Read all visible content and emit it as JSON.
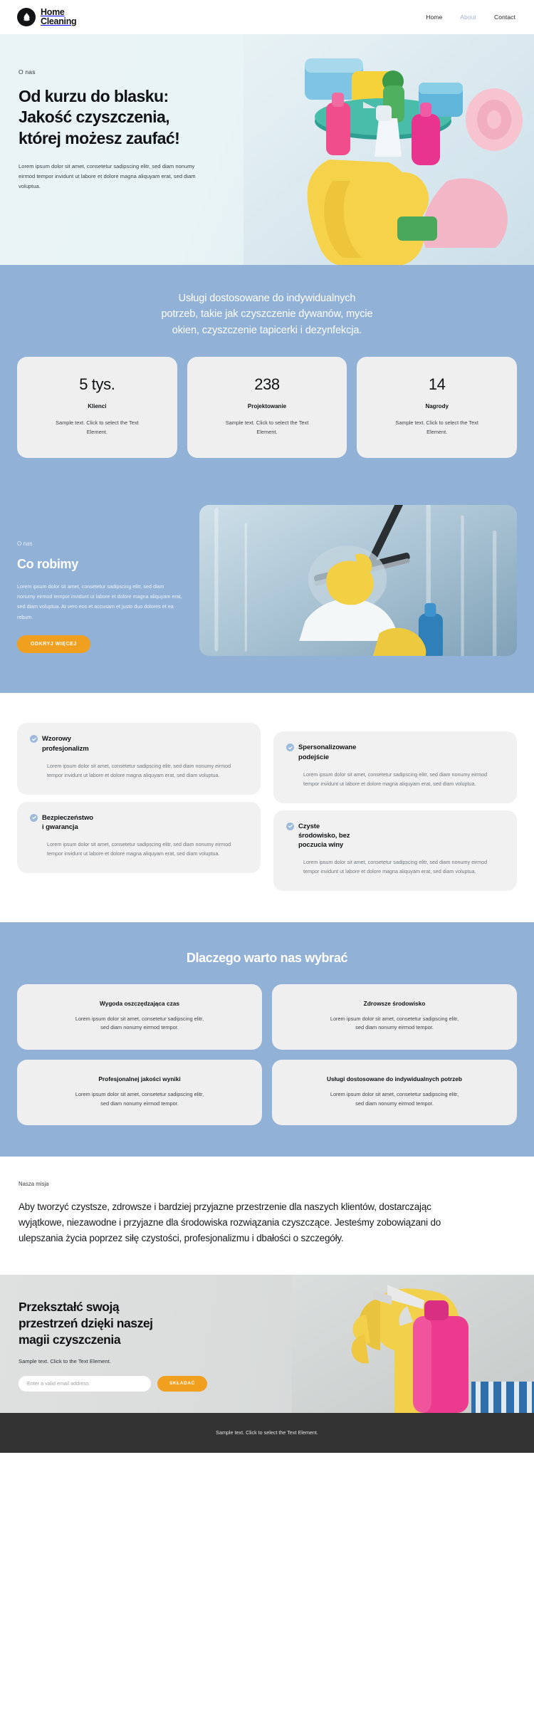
{
  "header": {
    "brand_name": "Home\nCleaning",
    "nav": [
      {
        "label": "Home",
        "muted": false
      },
      {
        "label": "About",
        "muted": true
      },
      {
        "label": "Contact",
        "muted": false
      }
    ]
  },
  "hero": {
    "eyebrow": "O nas",
    "title": "Od kurzu do blasku:\nJakość czyszczenia,\nktórej możesz zaufać!",
    "text": "Lorem ipsum dolor sit amet, consetetur sadipscing elitr, sed diam nonumy eirmod tempor invidunt ut labore et dolore magna aliquyam erat, sed diam voluptua."
  },
  "services": {
    "heading": "Usługi dostosowane do indywidualnych\npotrzeb, takie jak czyszczenie dywanów, mycie\nokien, czyszczenie tapicerki i dezynfekcja.",
    "stats": [
      {
        "value": "5 tys.",
        "label": "Klienci",
        "desc": "Sample text. Click to select the Text Element."
      },
      {
        "value": "238",
        "label": "Projektowanie",
        "desc": "Sample text. Click to select the Text Element."
      },
      {
        "value": "14",
        "label": "Nagrody",
        "desc": "Sample text. Click to select the Text Element."
      }
    ]
  },
  "about": {
    "eyebrow": "O nas",
    "title": "Co robimy",
    "text": "Lorem ipsum dolor sit amet, consetetur sadipscing elitr, sed diam nonumy eirmod tempor invidunt ut labore et dolore magna aliquyam erat, sed diam voluptua. At vero eos et accusam et justo duo dolores et ea rebum.",
    "button_label": "ODKRYJ WIĘCEJ"
  },
  "features": [
    {
      "title": "Wzorowy\nprofesjonalizm",
      "text": "Lorem ipsum dolor sit amet, consetetur sadipscing elitr, sed diam nonumy eirmod tempor invidunt ut labore et dolore magna aliquyam erat, sed diam voluptua."
    },
    {
      "title": "Spersonalizowane\npodejście",
      "text": "Lorem ipsum dolor sit amet, consetetur sadipscing elitr, sed diam nonumy eirmod tempor invidunt ut labore et dolore magna aliquyam erat, sed diam voluptua."
    },
    {
      "title": "Bezpieczeństwo\ni gwarancja",
      "text": "Lorem ipsum dolor sit amet, consetetur sadipscing elitr, sed diam nonumy eirmod tempor invidunt ut labore et dolore magna aliquyam erat, sed diam voluptua."
    },
    {
      "title": "Czyste\nśrodowisko, bez\npoczucia winy",
      "text": "Lorem ipsum dolor sit amet, consetetur sadipscing elitr, sed diam nonumy eirmod tempor invidunt ut labore et dolore magna aliquyam erat, sed diam voluptua."
    }
  ],
  "why": {
    "title": "Dlaczego warto nas wybrać",
    "cards": [
      {
        "title": "Wygoda oszczędzająca czas",
        "text": "Lorem ipsum dolor sit amet, consetetur sadipscing elitr, sed diam nonumy eirmod tempor."
      },
      {
        "title": "Zdrowsze środowisko",
        "text": "Lorem ipsum dolor sit amet, consetetur sadipscing elitr, sed diam nonumy eirmod tempor."
      },
      {
        "title": "Profesjonalnej jakości wyniki",
        "text": "Lorem ipsum dolor sit amet, consetetur sadipscing elitr, sed diam nonumy eirmod tempor."
      },
      {
        "title": "Usługi dostosowane do indywidualnych potrzeb",
        "text": "Lorem ipsum dolor sit amet, consetetur sadipscing elitr, sed diam nonumy eirmod tempor."
      }
    ]
  },
  "mission": {
    "eyebrow": "Nasza misja",
    "text": "Aby tworzyć czystsze, zdrowsze i bardziej przyjazne przestrzenie dla naszych klientów, dostarczając wyjątkowe, niezawodne i przyjazne dla środowiska rozwiązania czyszczące. Jesteśmy zobowiązani do ulepszania życia poprzez siłę czystości, profesjonalizmu i dbałości o szczegóły."
  },
  "cta": {
    "title": "Przekształć swoją\nprzestrzeń dzięki naszej\nmagii czyszczenia",
    "subtitle": "Sample text. Click to the Text Element.",
    "email_placeholder": "Enter a valid email address",
    "email_value": "",
    "submit_label": "SKŁADAĆ"
  },
  "footer": {
    "text": "Sample text. Click to select the Text Element."
  },
  "colors": {
    "brand_dark": "#111315",
    "band_blue": "#92b1d6",
    "accent_orange": "#f0a01e",
    "card_gray": "#efefef",
    "footer_dark": "#333334",
    "check_blue": "#9dbada"
  }
}
